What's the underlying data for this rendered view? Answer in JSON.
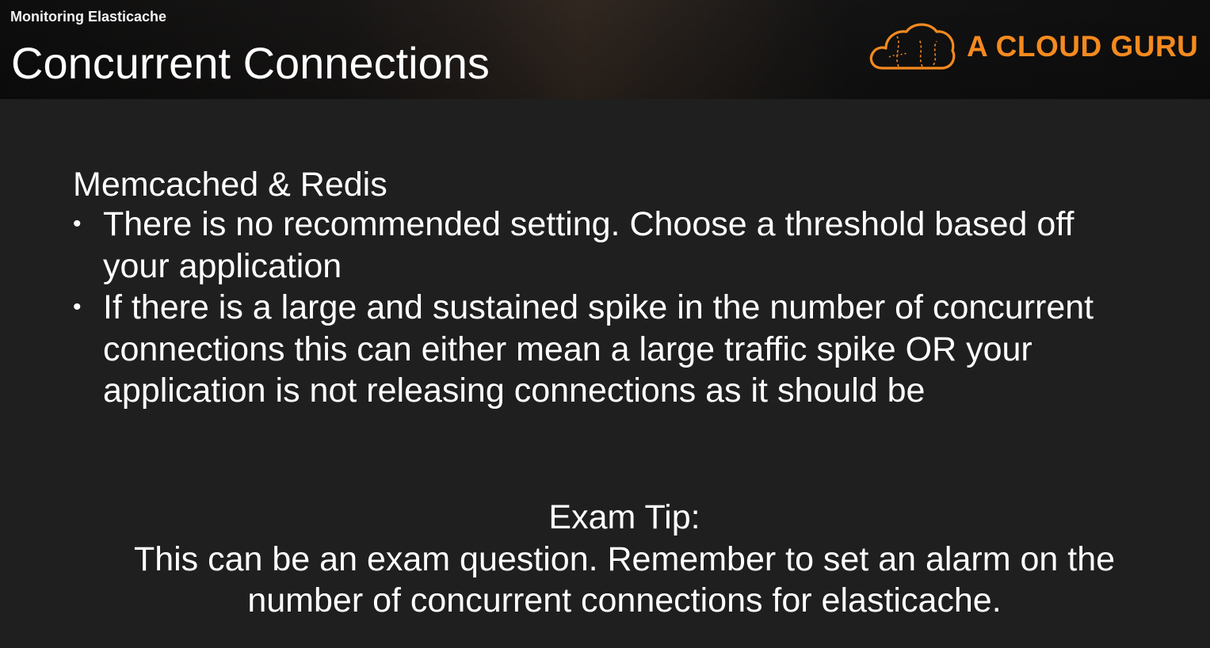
{
  "header": {
    "breadcrumb": "Monitoring Elasticache",
    "title": "Concurrent Connections",
    "logo": {
      "text": "A CLOUD GURU",
      "icon": "cloud-logo-icon",
      "color": "#f58a1f"
    }
  },
  "main": {
    "heading": "Memcached & Redis",
    "bullets": [
      {
        "marker": "•",
        "lines": [
          "There is no recommended setting. Choose a threshold based off",
          "your application"
        ]
      },
      {
        "marker": "•",
        "lines": [
          "If there is a large and sustained spike in the number of concurrent",
          "connections this can either mean a large traffic spike OR your",
          "application is not releasing connections as it should be"
        ]
      }
    ]
  },
  "tip": {
    "heading": "Exam Tip:",
    "lines": [
      "This can be an exam question. Remember to set an alarm on the",
      "number of concurrent connections for elasticache."
    ]
  }
}
